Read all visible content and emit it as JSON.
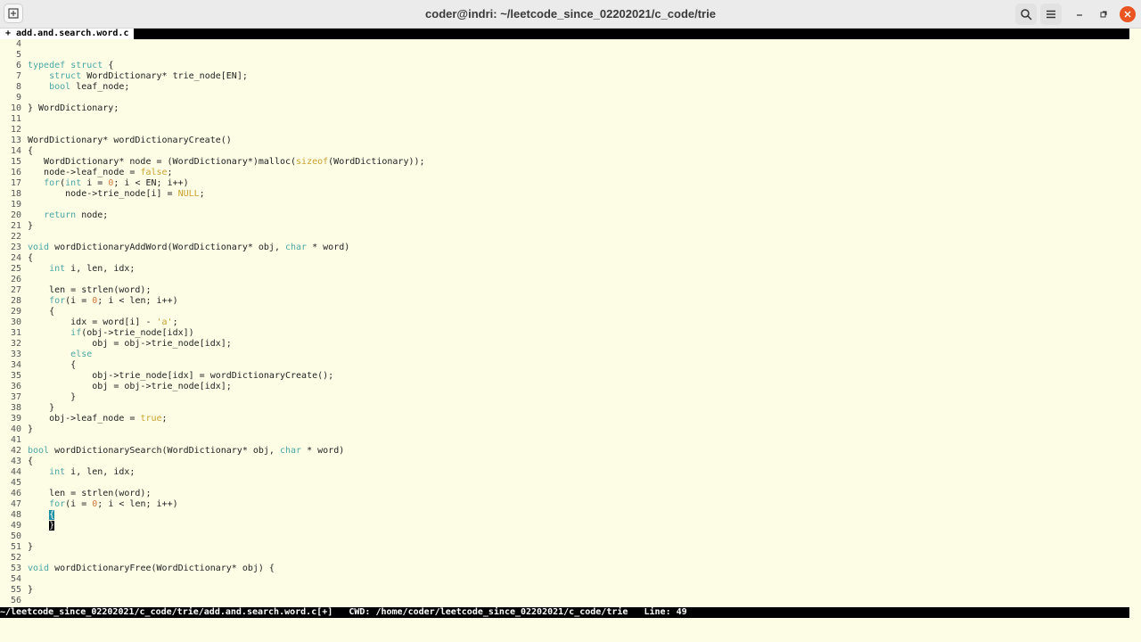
{
  "window": {
    "title": "coder@indri: ~/leetcode_since_02202021/c_code/trie"
  },
  "tab": {
    "label": "+ add.and.search.word.c"
  },
  "status": {
    "path": "~/leetcode_since_02202021/c_code/trie/add.and.search.word.c[+]",
    "cwd": "CWD: /home/coder/leetcode_since_02202021/c_code/trie",
    "line": "Line: 49"
  },
  "icons": {
    "new_tab": "new-tab-icon",
    "search": "search-icon",
    "menu": "hamburger-menu-icon",
    "minimize": "minimize-icon",
    "maximize": "maximize-icon",
    "close": "close-icon"
  },
  "colors": {
    "keyword": "#4aa6a2",
    "number": "#d07a3a",
    "constant": "#c9a22e",
    "background": "#fdfde6",
    "close_button": "#e95420"
  },
  "code_lines": [
    {
      "n": "4",
      "tokens": []
    },
    {
      "n": "5",
      "tokens": []
    },
    {
      "n": "6",
      "tokens": [
        [
          "kw",
          "typedef"
        ],
        [
          "t",
          " "
        ],
        [
          "kw",
          "struct"
        ],
        [
          "t",
          " {"
        ]
      ]
    },
    {
      "n": "7",
      "tokens": [
        [
          "t",
          "    "
        ],
        [
          "kw",
          "struct"
        ],
        [
          "t",
          " WordDictionary* trie_node[EN];"
        ]
      ]
    },
    {
      "n": "8",
      "tokens": [
        [
          "t",
          "    "
        ],
        [
          "kw",
          "bool"
        ],
        [
          "t",
          " leaf_node;"
        ]
      ]
    },
    {
      "n": "9",
      "tokens": []
    },
    {
      "n": "10",
      "tokens": [
        [
          "t",
          "} WordDictionary;"
        ]
      ]
    },
    {
      "n": "11",
      "tokens": []
    },
    {
      "n": "12",
      "tokens": []
    },
    {
      "n": "13",
      "tokens": [
        [
          "t",
          "WordDictionary* wordDictionaryCreate()"
        ]
      ]
    },
    {
      "n": "14",
      "tokens": [
        [
          "t",
          "{"
        ]
      ]
    },
    {
      "n": "15",
      "tokens": [
        [
          "t",
          "   WordDictionary* node = (WordDictionary*)malloc("
        ],
        [
          "cst",
          "sizeof"
        ],
        [
          "t",
          "(WordDictionary));"
        ]
      ]
    },
    {
      "n": "16",
      "tokens": [
        [
          "t",
          "   node->leaf_node = "
        ],
        [
          "cst",
          "false"
        ],
        [
          "t",
          ";"
        ]
      ]
    },
    {
      "n": "17",
      "tokens": [
        [
          "t",
          "   "
        ],
        [
          "kw",
          "for"
        ],
        [
          "t",
          "("
        ],
        [
          "kw",
          "int"
        ],
        [
          "t",
          " i = "
        ],
        [
          "num",
          "0"
        ],
        [
          "t",
          "; i < EN; i++)"
        ]
      ]
    },
    {
      "n": "18",
      "tokens": [
        [
          "t",
          "       node->trie_node[i] = "
        ],
        [
          "cst",
          "NULL"
        ],
        [
          "t",
          ";"
        ]
      ]
    },
    {
      "n": "19",
      "tokens": []
    },
    {
      "n": "20",
      "tokens": [
        [
          "t",
          "   "
        ],
        [
          "kw",
          "return"
        ],
        [
          "t",
          " node;"
        ]
      ]
    },
    {
      "n": "21",
      "tokens": [
        [
          "t",
          "}"
        ]
      ]
    },
    {
      "n": "22",
      "tokens": []
    },
    {
      "n": "23",
      "tokens": [
        [
          "kw",
          "void"
        ],
        [
          "t",
          " wordDictionaryAddWord(WordDictionary* obj, "
        ],
        [
          "kw",
          "char"
        ],
        [
          "t",
          " * word)"
        ]
      ]
    },
    {
      "n": "24",
      "tokens": [
        [
          "t",
          "{"
        ]
      ]
    },
    {
      "n": "25",
      "tokens": [
        [
          "t",
          "    "
        ],
        [
          "kw",
          "int"
        ],
        [
          "t",
          " i, len, idx;"
        ]
      ]
    },
    {
      "n": "26",
      "tokens": []
    },
    {
      "n": "27",
      "tokens": [
        [
          "t",
          "    len = strlen(word);"
        ]
      ]
    },
    {
      "n": "28",
      "tokens": [
        [
          "t",
          "    "
        ],
        [
          "kw",
          "for"
        ],
        [
          "t",
          "(i = "
        ],
        [
          "num",
          "0"
        ],
        [
          "t",
          "; i < len; i++)"
        ]
      ]
    },
    {
      "n": "29",
      "tokens": [
        [
          "t",
          "    {"
        ]
      ]
    },
    {
      "n": "30",
      "tokens": [
        [
          "t",
          "        idx = word[i] - "
        ],
        [
          "str",
          "'a'"
        ],
        [
          "t",
          ";"
        ]
      ]
    },
    {
      "n": "31",
      "tokens": [
        [
          "t",
          "        "
        ],
        [
          "kw",
          "if"
        ],
        [
          "t",
          "(obj->trie_node[idx])"
        ]
      ]
    },
    {
      "n": "32",
      "tokens": [
        [
          "t",
          "            obj = obj->trie_node[idx];"
        ]
      ]
    },
    {
      "n": "33",
      "tokens": [
        [
          "t",
          "        "
        ],
        [
          "kw",
          "else"
        ]
      ]
    },
    {
      "n": "34",
      "tokens": [
        [
          "t",
          "        {"
        ]
      ]
    },
    {
      "n": "35",
      "tokens": [
        [
          "t",
          "            obj->trie_node[idx] = wordDictionaryCreate();"
        ]
      ]
    },
    {
      "n": "36",
      "tokens": [
        [
          "t",
          "            obj = obj->trie_node[idx];"
        ]
      ]
    },
    {
      "n": "37",
      "tokens": [
        [
          "t",
          "        }"
        ]
      ]
    },
    {
      "n": "38",
      "tokens": [
        [
          "t",
          "    }"
        ]
      ]
    },
    {
      "n": "39",
      "tokens": [
        [
          "t",
          "    obj->leaf_node = "
        ],
        [
          "cst",
          "true"
        ],
        [
          "t",
          ";"
        ]
      ]
    },
    {
      "n": "40",
      "tokens": [
        [
          "t",
          "}"
        ]
      ]
    },
    {
      "n": "41",
      "tokens": []
    },
    {
      "n": "42",
      "tokens": [
        [
          "kw",
          "bool"
        ],
        [
          "t",
          " wordDictionarySearch(WordDictionary* obj, "
        ],
        [
          "kw",
          "char"
        ],
        [
          "t",
          " * word)"
        ]
      ]
    },
    {
      "n": "43",
      "tokens": [
        [
          "t",
          "{"
        ]
      ]
    },
    {
      "n": "44",
      "tokens": [
        [
          "t",
          "    "
        ],
        [
          "kw",
          "int"
        ],
        [
          "t",
          " i, len, idx;"
        ]
      ]
    },
    {
      "n": "45",
      "tokens": []
    },
    {
      "n": "46",
      "tokens": [
        [
          "t",
          "    len = strlen(word);"
        ]
      ]
    },
    {
      "n": "47",
      "tokens": [
        [
          "t",
          "    "
        ],
        [
          "kw",
          "for"
        ],
        [
          "t",
          "(i = "
        ],
        [
          "num",
          "0"
        ],
        [
          "t",
          "; i < len; i++)"
        ]
      ]
    },
    {
      "n": "48",
      "tokens": [
        [
          "t",
          "    "
        ],
        [
          "hl",
          "{"
        ]
      ]
    },
    {
      "n": "49",
      "tokens": [
        [
          "t",
          "    "
        ],
        [
          "cur",
          "}"
        ]
      ]
    },
    {
      "n": "50",
      "tokens": []
    },
    {
      "n": "51",
      "tokens": [
        [
          "t",
          "}"
        ]
      ]
    },
    {
      "n": "52",
      "tokens": []
    },
    {
      "n": "53",
      "tokens": [
        [
          "kw",
          "void"
        ],
        [
          "t",
          " wordDictionaryFree(WordDictionary* obj) {"
        ]
      ]
    },
    {
      "n": "54",
      "tokens": []
    },
    {
      "n": "55",
      "tokens": [
        [
          "t",
          "}"
        ]
      ]
    },
    {
      "n": "56",
      "tokens": []
    }
  ]
}
